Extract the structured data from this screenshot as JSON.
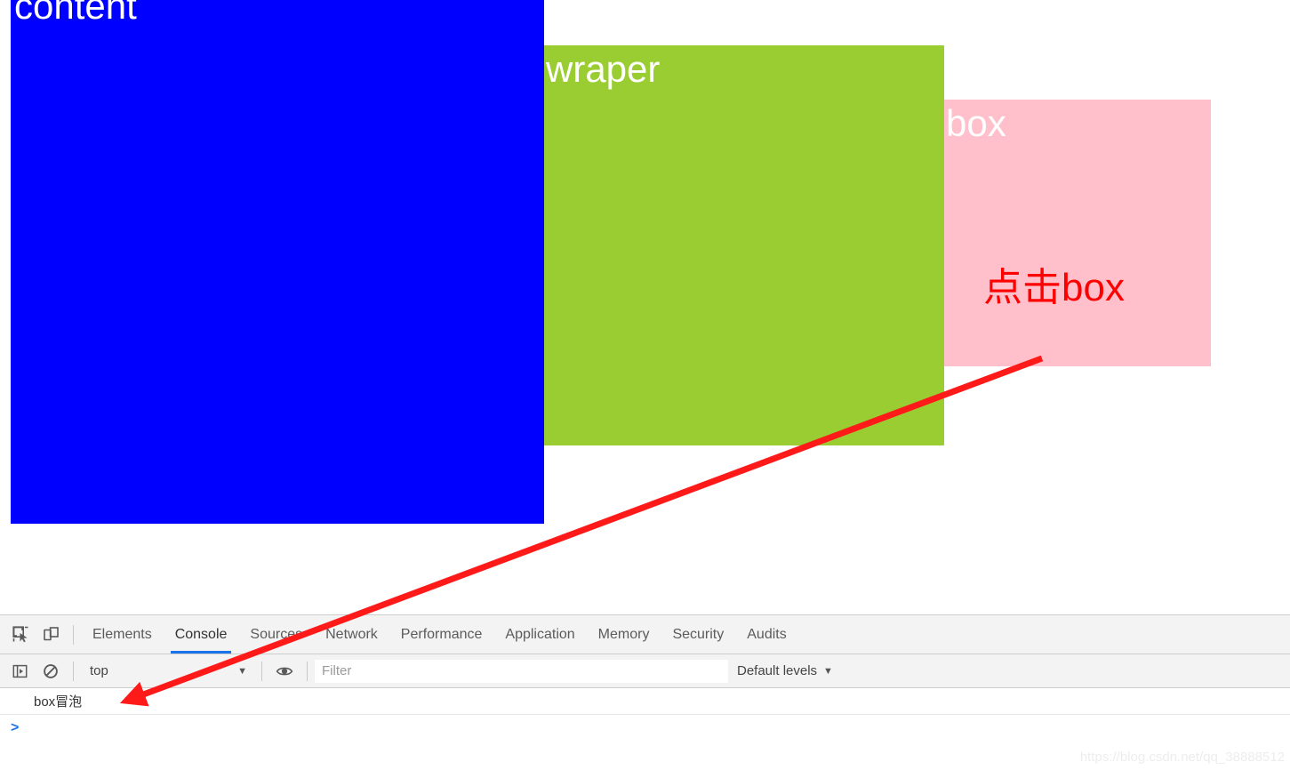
{
  "page": {
    "content_label": "content",
    "wraper_label": "wraper",
    "box_label": "box",
    "box_inner_text": "点击box",
    "colors": {
      "content_bg": "#0000ff",
      "wraper_bg": "#9acd32",
      "box_bg": "#ffc0cb",
      "box_inner_text_color": "#ff0000",
      "annotation_arrow": "#ff1a1a"
    }
  },
  "devtools": {
    "icons": {
      "inspect": "inspect-element-icon",
      "device": "device-toolbar-icon",
      "sidebar": "console-sidebar-icon",
      "clear": "clear-console-icon",
      "eye": "live-expression-eye-icon"
    },
    "tabs": [
      {
        "label": "Elements",
        "active": false
      },
      {
        "label": "Console",
        "active": true
      },
      {
        "label": "Sources",
        "active": false
      },
      {
        "label": "Network",
        "active": false
      },
      {
        "label": "Performance",
        "active": false
      },
      {
        "label": "Application",
        "active": false
      },
      {
        "label": "Memory",
        "active": false
      },
      {
        "label": "Security",
        "active": false
      },
      {
        "label": "Audits",
        "active": false
      }
    ],
    "context": {
      "value": "top",
      "caret": "▼"
    },
    "filter": {
      "value": "",
      "placeholder": "Filter"
    },
    "levels": {
      "label": "Default levels",
      "caret": "▼"
    },
    "console_messages": [
      {
        "text": "box冒泡"
      }
    ],
    "prompt_caret": ">"
  },
  "watermark": "https://blog.csdn.net/qq_38888512"
}
